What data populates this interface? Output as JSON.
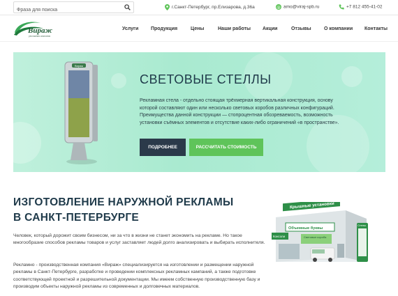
{
  "topbar": {
    "search_placeholder": "Фраза для поиска",
    "address": "г.Санкт-Петербург, пр.Елизарова, д.36а",
    "email": "amo@viraj-spb.ru",
    "phone": "+7 812 455-41-02"
  },
  "logo": {
    "name": "Вираж",
    "tagline": "рекламная компания"
  },
  "nav": {
    "items": [
      {
        "label": "Услуги"
      },
      {
        "label": "Продукция"
      },
      {
        "label": "Цены"
      },
      {
        "label": "Наши работы"
      },
      {
        "label": "Акции"
      },
      {
        "label": "Отзывы"
      },
      {
        "label": "О компании"
      },
      {
        "label": "Контакты"
      }
    ]
  },
  "hero": {
    "title": "СВЕТОВЫЕ СТЕЛЛЫ",
    "text": "Рекламная стела - отдельно стоящая трёхмерная вертикальная конструкция, основу которой составляют один или несколько световых коробов различных конфигураций. Преимущества данной конструкции — стопроцентная обозреваемость, возможность установки съёмных элементов и отсутствие каких-либо ограничений «в пространстве».",
    "btn_more": "ПОДРОБНЕЕ",
    "btn_calc": "РАССЧИТАТЬ СТОИМОСТЬ",
    "stand_label": "Вираж"
  },
  "content": {
    "heading": "ИЗГОТОВЛЕНИЕ НАРУЖНОЙ РЕКЛАМЫ В САНКТ-ПЕТЕРБУРГЕ",
    "p1": "Человек, который дорожит своим бизнесом, ни за что в жизни не станет экономить на рекламе. Но такое многообразие способов рекламы товаров и услуг заставляет людей долго анализировать и выбирать исполнителя.",
    "p2": "Рекламно - производственная компания «Вираж» специализируется на изготовлении и размещении наружной рекламы в Санкт-Петербурге, разработке и проведении комплексных рекламных кампаний, а также подготовке соответствующей проектной и разрешительной документации. Мы имеем собственную производственную базу и производим объекты наружной рекламы из современных и долговечных материалов."
  },
  "illustration": {
    "sign_roof": "Крышные установки",
    "sign_letters": "Объемные буквы",
    "sign_boxes": "Световые короба",
    "sign_console": "Консоли",
    "sign_stella": "Стелы"
  },
  "colors": {
    "accent_green": "#5fc45a",
    "dark": "#2b3a4a",
    "hero_bg": "#b5eeda"
  }
}
